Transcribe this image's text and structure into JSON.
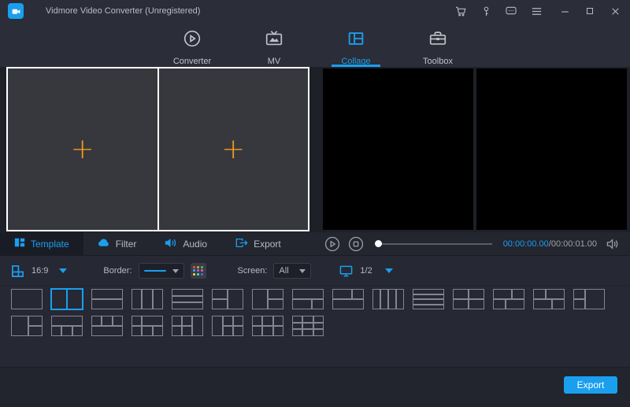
{
  "window": {
    "title": "Vidmore Video Converter (Unregistered)"
  },
  "nav": {
    "tabs": [
      {
        "label": "Converter",
        "active": false
      },
      {
        "label": "MV",
        "active": false
      },
      {
        "label": "Collage",
        "active": true
      },
      {
        "label": "Toolbox",
        "active": false
      }
    ]
  },
  "editor": {
    "add_symbol": "+"
  },
  "panel_tabs": [
    {
      "label": "Template",
      "active": true
    },
    {
      "label": "Filter",
      "active": false
    },
    {
      "label": "Audio",
      "active": false
    },
    {
      "label": "Export",
      "active": false
    }
  ],
  "player": {
    "current_time": "00:00:00.00",
    "separator": "/",
    "total_time": "00:00:01.00"
  },
  "toolbar": {
    "aspect_ratio": "16:9",
    "border_label": "Border:",
    "screen_label": "Screen:",
    "screen_value": "All",
    "page": "1/2"
  },
  "footer": {
    "export_label": "Export"
  },
  "colors": {
    "accent": "#1a9fef",
    "plus_orange": "#f39b1c",
    "template_line": "#83858f"
  },
  "templates": {
    "selected": {
      "row": 1,
      "index": 1
    },
    "row1": [
      [
        [
          0,
          0,
          1,
          1
        ]
      ],
      [
        [
          0,
          0,
          0.5,
          1
        ],
        [
          0.5,
          0,
          0.5,
          1
        ]
      ],
      [
        [
          0,
          0,
          1,
          0.5
        ],
        [
          0,
          0.5,
          1,
          0.5
        ]
      ],
      [
        [
          0,
          0,
          0.33,
          1
        ],
        [
          0.33,
          0,
          0.34,
          1
        ],
        [
          0.67,
          0,
          0.33,
          1
        ]
      ],
      [
        [
          0,
          0,
          1,
          0.33
        ],
        [
          0,
          0.33,
          1,
          0.34
        ],
        [
          0,
          0.67,
          1,
          0.33
        ]
      ],
      [
        [
          0,
          0,
          0.5,
          0.5
        ],
        [
          0,
          0.5,
          0.5,
          0.5
        ],
        [
          0.5,
          0,
          0.5,
          1
        ]
      ],
      [
        [
          0,
          0,
          0.5,
          1
        ],
        [
          0.5,
          0,
          0.5,
          0.5
        ],
        [
          0.5,
          0.5,
          0.5,
          0.5
        ]
      ],
      [
        [
          0,
          0,
          1,
          0.5
        ],
        [
          0,
          0.5,
          0.62,
          0.5
        ],
        [
          0.62,
          0.5,
          0.38,
          0.5
        ]
      ],
      [
        [
          0,
          0,
          0.62,
          0.5
        ],
        [
          0.62,
          0,
          0.38,
          0.5
        ],
        [
          0,
          0.5,
          1,
          0.5
        ]
      ],
      [
        [
          0,
          0,
          0.25,
          1
        ],
        [
          0.25,
          0,
          0.25,
          1
        ],
        [
          0.5,
          0,
          0.25,
          1
        ],
        [
          0.75,
          0,
          0.25,
          1
        ]
      ],
      [
        [
          0,
          0,
          1,
          0.25
        ],
        [
          0,
          0.25,
          1,
          0.25
        ],
        [
          0,
          0.5,
          1,
          0.25
        ],
        [
          0,
          0.75,
          1,
          0.25
        ]
      ],
      [
        [
          0,
          0,
          0.5,
          0.5
        ],
        [
          0.5,
          0,
          0.5,
          0.5
        ],
        [
          0,
          0.5,
          0.5,
          0.5
        ],
        [
          0.5,
          0.5,
          0.5,
          0.5
        ]
      ],
      [
        [
          0,
          0,
          0.6,
          0.5
        ],
        [
          0.6,
          0,
          0.4,
          0.5
        ],
        [
          0,
          0.5,
          0.4,
          0.5
        ],
        [
          0.4,
          0.5,
          0.6,
          0.5
        ]
      ],
      [
        [
          0,
          0,
          0.4,
          0.5
        ],
        [
          0.4,
          0,
          0.6,
          0.5
        ],
        [
          0,
          0.5,
          0.6,
          0.5
        ],
        [
          0.6,
          0.5,
          0.4,
          0.5
        ]
      ],
      [
        [
          0,
          0,
          0.38,
          0.5
        ],
        [
          0,
          0.5,
          0.38,
          0.5
        ],
        [
          0.38,
          0,
          0.62,
          1
        ]
      ]
    ],
    "row2": [
      [
        [
          0,
          0,
          0.55,
          1
        ],
        [
          0.55,
          0,
          0.45,
          0.5
        ],
        [
          0.55,
          0.5,
          0.45,
          0.5
        ]
      ],
      [
        [
          0,
          0,
          1,
          0.5
        ],
        [
          0,
          0.5,
          0.33,
          0.5
        ],
        [
          0.33,
          0.5,
          0.34,
          0.5
        ],
        [
          0.67,
          0.5,
          0.33,
          0.5
        ]
      ],
      [
        [
          0,
          0,
          0.33,
          0.5
        ],
        [
          0.33,
          0,
          0.34,
          0.5
        ],
        [
          0.67,
          0,
          0.33,
          0.5
        ],
        [
          0,
          0.5,
          1,
          0.5
        ]
      ],
      [
        [
          0,
          0,
          0.33,
          0.5
        ],
        [
          0.33,
          0,
          0.67,
          0.5
        ],
        [
          0,
          0.5,
          0.33,
          0.5
        ],
        [
          0.33,
          0.5,
          0.34,
          0.5
        ],
        [
          0.67,
          0.5,
          0.33,
          0.5
        ]
      ],
      [
        [
          0,
          0,
          0.33,
          0.5
        ],
        [
          0.33,
          0,
          0.33,
          0.5
        ],
        [
          0,
          0.5,
          0.33,
          0.5
        ],
        [
          0.33,
          0.5,
          0.33,
          0.5
        ],
        [
          0.66,
          0,
          0.34,
          1
        ]
      ],
      [
        [
          0,
          0,
          0.34,
          1
        ],
        [
          0.34,
          0,
          0.33,
          0.5
        ],
        [
          0.67,
          0,
          0.33,
          0.5
        ],
        [
          0.34,
          0.5,
          0.33,
          0.5
        ],
        [
          0.67,
          0.5,
          0.33,
          0.5
        ]
      ],
      [
        [
          0,
          0,
          0.33,
          0.5
        ],
        [
          0.33,
          0,
          0.34,
          0.5
        ],
        [
          0.67,
          0,
          0.33,
          0.5
        ],
        [
          0,
          0.5,
          0.33,
          0.5
        ],
        [
          0.33,
          0.5,
          0.34,
          0.5
        ],
        [
          0.67,
          0.5,
          0.33,
          0.5
        ]
      ],
      [
        [
          0,
          0,
          0.33,
          0.33
        ],
        [
          0.33,
          0,
          0.34,
          0.33
        ],
        [
          0.67,
          0,
          0.33,
          0.33
        ],
        [
          0,
          0.33,
          0.33,
          0.34
        ],
        [
          0.33,
          0.33,
          0.34,
          0.34
        ],
        [
          0.67,
          0.33,
          0.33,
          0.34
        ],
        [
          0,
          0.67,
          0.33,
          0.33
        ],
        [
          0.33,
          0.67,
          0.34,
          0.33
        ],
        [
          0.67,
          0.67,
          0.33,
          0.33
        ]
      ]
    ]
  }
}
